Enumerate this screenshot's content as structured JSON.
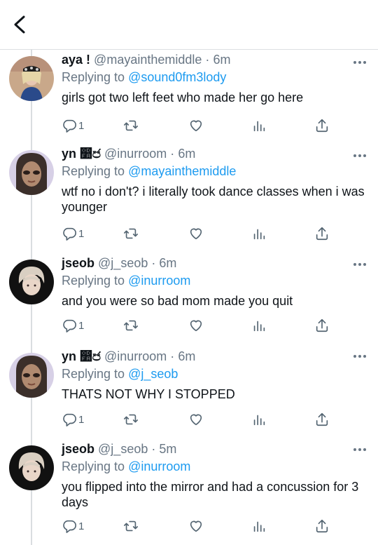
{
  "tweets": [
    {
      "name": "aya !",
      "handle": "@mayainthemiddle",
      "time": "6m",
      "replying_prefix": "Replying to",
      "replying_to": "@sound0fm3lody",
      "text": "girls got two left feet who made her go here",
      "reply_count": "1",
      "avatar": "avatar-aya"
    },
    {
      "name": "yn ෺෪",
      "handle": "@inurroom",
      "time": "6m",
      "replying_prefix": "Replying to",
      "replying_to": "@mayainthemiddle",
      "text": "wtf no i don't? i literally took dance classes when i was younger",
      "reply_count": "1",
      "avatar": "avatar-yn"
    },
    {
      "name": "jseob",
      "handle": "@j_seob",
      "time": "6m",
      "replying_prefix": "Replying to",
      "replying_to": "@inurroom",
      "text": "and you were so bad mom made you quit",
      "reply_count": "1",
      "avatar": "avatar-jseob"
    },
    {
      "name": "yn ෺෪",
      "handle": "@inurroom",
      "time": "6m",
      "replying_prefix": "Replying to",
      "replying_to": "@j_seob",
      "text": "THATS NOT WHY I STOPPED",
      "reply_count": "1",
      "avatar": "avatar-yn"
    },
    {
      "name": "jseob",
      "handle": "@j_seob",
      "time": "5m",
      "replying_prefix": "Replying to",
      "replying_to": "@inurroom",
      "text": "you flipped into the mirror and had a concussion for 3 days",
      "reply_count": "1",
      "avatar": "avatar-jseob"
    }
  ],
  "colors": {
    "link": "#1d9bf0",
    "meta": "#687684",
    "text": "#0f1419",
    "divider": "#dcdfe2"
  },
  "icons": [
    "back-arrow-icon",
    "more-icon",
    "reply-icon",
    "retweet-icon",
    "like-icon",
    "analytics-icon",
    "share-icon"
  ]
}
